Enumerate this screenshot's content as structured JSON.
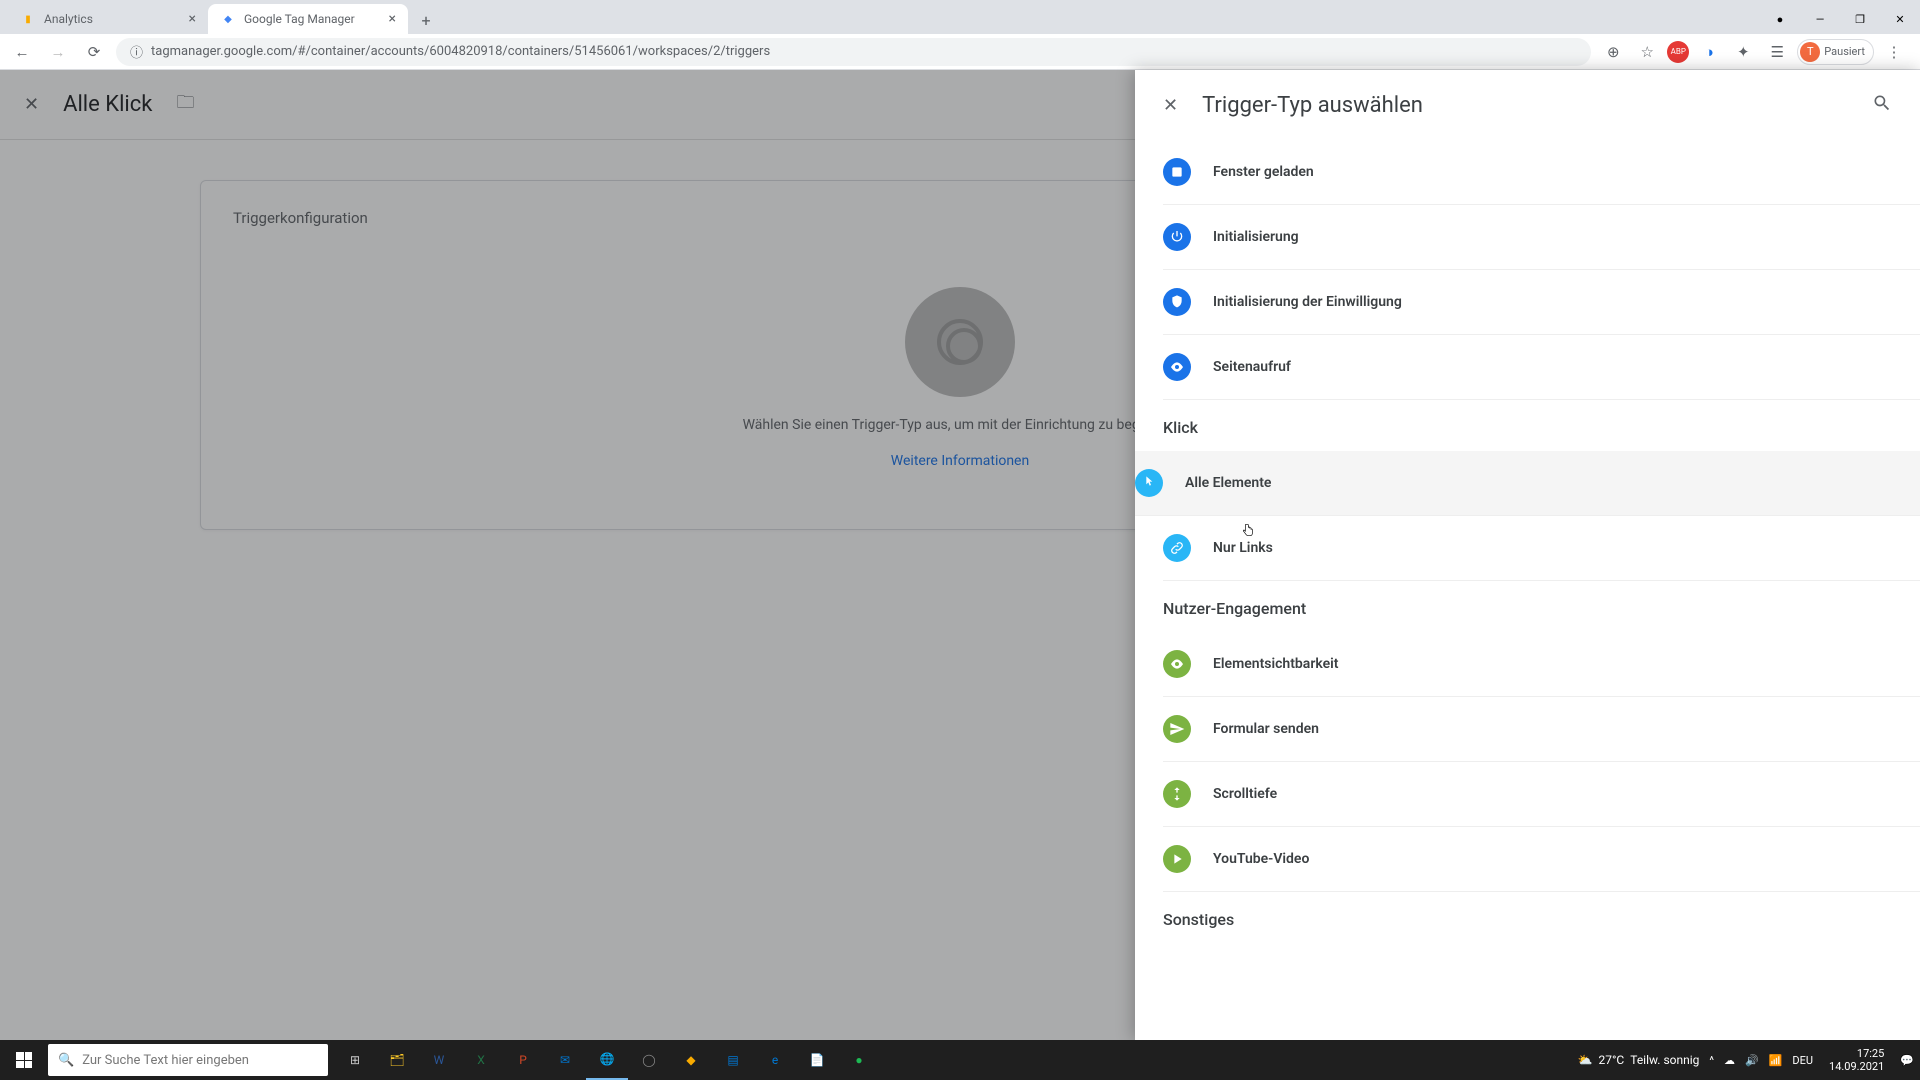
{
  "browser": {
    "tabs": [
      {
        "title": "Analytics",
        "favicon_color": "#f9ab00"
      },
      {
        "title": "Google Tag Manager",
        "favicon_color": "#4285f4"
      }
    ],
    "url": "tagmanager.google.com/#/container/accounts/6004820918/containers/51456061/workspaces/2/triggers",
    "profile_initial": "T",
    "profile_status": "Pausiert"
  },
  "editor": {
    "trigger_name": "Alle Klick",
    "card_title": "Triggerkonfiguration",
    "empty_prompt": "Wählen Sie einen Trigger-Typ aus, um mit der Einrichtung zu beginnen.",
    "learn_more": "Weitere Informationen"
  },
  "panel": {
    "title": "Trigger-Typ auswählen",
    "sections": [
      {
        "label": null,
        "items": [
          {
            "id": "window-loaded",
            "label": "Fenster geladen",
            "color": "#1a73e8",
            "icon": "square"
          },
          {
            "id": "initialization",
            "label": "Initialisierung",
            "color": "#1a73e8",
            "icon": "power"
          },
          {
            "id": "consent-init",
            "label": "Initialisierung der Einwilligung",
            "color": "#1a73e8",
            "icon": "shield"
          },
          {
            "id": "pageview",
            "label": "Seitenaufruf",
            "color": "#1a73e8",
            "icon": "eye"
          }
        ]
      },
      {
        "label": "Klick",
        "items": [
          {
            "id": "all-elements",
            "label": "Alle Elemente",
            "color": "#29b6f6",
            "icon": "pointer",
            "hovered": true
          },
          {
            "id": "just-links",
            "label": "Nur Links",
            "color": "#29b6f6",
            "icon": "link"
          }
        ]
      },
      {
        "label": "Nutzer-Engagement",
        "items": [
          {
            "id": "visibility",
            "label": "Elementsichtbarkeit",
            "color": "#7cb342",
            "icon": "eye"
          },
          {
            "id": "form-submit",
            "label": "Formular senden",
            "color": "#7cb342",
            "icon": "send"
          },
          {
            "id": "scroll-depth",
            "label": "Scrolltiefe",
            "color": "#7cb342",
            "icon": "scroll"
          },
          {
            "id": "youtube",
            "label": "YouTube-Video",
            "color": "#7cb342",
            "icon": "play"
          }
        ]
      },
      {
        "label": "Sonstiges",
        "items": []
      }
    ]
  },
  "taskbar": {
    "search_placeholder": "Zur Suche Text hier eingeben",
    "weather_temp": "27°C",
    "weather_desc": "Teilw. sonnig",
    "lang": "DEU",
    "time": "17:25",
    "date": "14.09.2021"
  }
}
